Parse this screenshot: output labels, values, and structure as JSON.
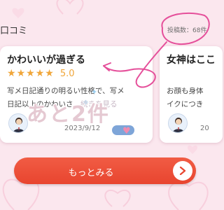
{
  "theme": {
    "accent": "#e8452f",
    "star_color": "#f0a63a",
    "background": "#fbe7ee",
    "annotation": "#e54f9a"
  },
  "section": {
    "title": "口コミ",
    "post_count": "投稿数：68件"
  },
  "cards": [
    {
      "title": "かわいいが過ぎる",
      "stars": 5,
      "rating": "5.0",
      "text_line1": "写メ日記通りの明るい性格で、写メ",
      "text_line2": "日記以上のかわいさ…",
      "read_more": "続きを見る",
      "date": "2023/9/12"
    },
    {
      "title": "女神はここ",
      "text_line1": "お顔も身体",
      "text_line2": "イクにつき",
      "date": "20"
    }
  ],
  "overlay": {
    "text": "あと2件",
    "heart": "♥"
  },
  "button": {
    "label": "もっとみる"
  }
}
